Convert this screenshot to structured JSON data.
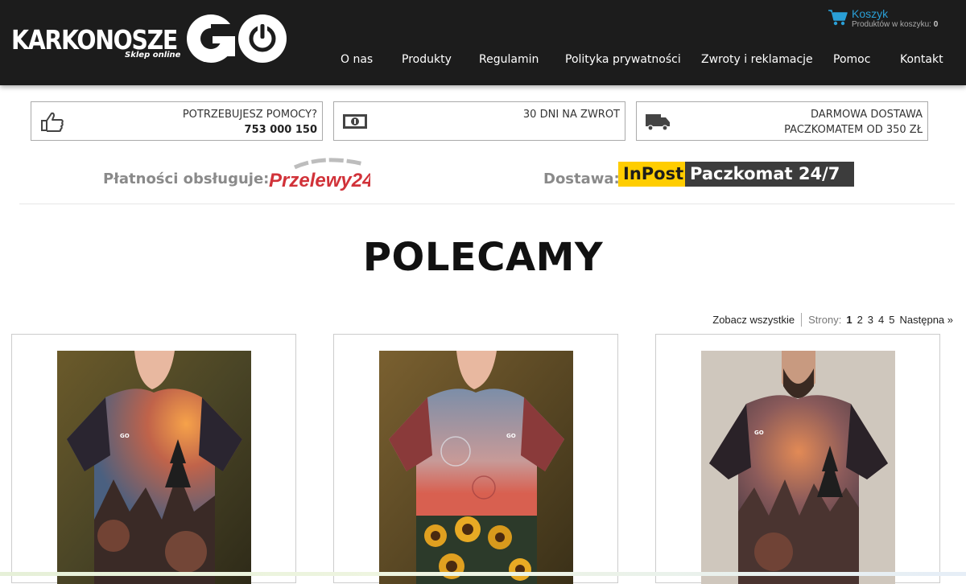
{
  "header": {
    "logo": {
      "name": "KARKONOSZE",
      "go": "GO",
      "tagline": "Sklep online"
    },
    "cart": {
      "title": "Koszyk",
      "info_label": "Produktów w koszyku:",
      "count": "0"
    },
    "nav": [
      "O nas",
      "Produkty",
      "Regulamin",
      "Polityka prywatności",
      "Zwroty i reklamacje",
      "Pomoc",
      "Kontakt"
    ]
  },
  "info_boxes": [
    {
      "icon": "thumbs-up-icon",
      "line1": "POTRZEBUJESZ POMOCY?",
      "line2": "753 000 150"
    },
    {
      "icon": "money-icon",
      "line1": "30 DNI NA ZWROT",
      "line2": ""
    },
    {
      "icon": "truck-icon",
      "line1": "DARMOWA DOSTAWA",
      "line2": "PACZKOMATEM OD 350 ZŁ"
    }
  ],
  "payments": {
    "payment_label": "Płatności obsługuje:",
    "payment_provider": "Przelewy24",
    "delivery_label": "Dostawa:",
    "delivery_brand": "InPost",
    "delivery_product": "Paczkomat 24/7"
  },
  "section": {
    "title": "POLECAMY"
  },
  "pager": {
    "see_all": "Zobacz wszystkie",
    "pages_label": "Strony:",
    "pages": [
      "1",
      "2",
      "3",
      "4",
      "5"
    ],
    "current": "1",
    "next": "Następna »"
  },
  "products": [
    {
      "image": "woman-tshirt-sunset-forest"
    },
    {
      "image": "woman-tshirt-sunflowers"
    },
    {
      "image": "man-tshirt-sunset-forest"
    }
  ],
  "colors": {
    "header_bg": "#1c1c1c",
    "cart_accent": "#2a9fd6",
    "inpost_yellow": "#ffcd00",
    "p24_red": "#d13239"
  }
}
